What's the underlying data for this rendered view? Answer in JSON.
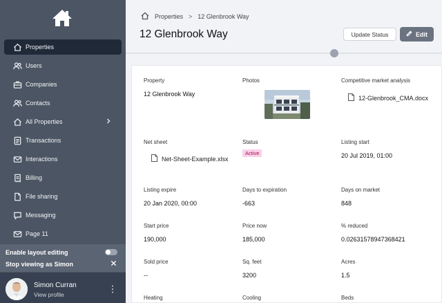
{
  "sidebar": {
    "items": [
      {
        "label": "Properties",
        "icon": "home-icon",
        "active": true
      },
      {
        "label": "Users",
        "icon": "users-icon"
      },
      {
        "label": "Companies",
        "icon": "briefcase-icon"
      },
      {
        "label": "Contacts",
        "icon": "contacts-icon"
      },
      {
        "label": "All Properties",
        "icon": "home-icon",
        "has_submenu": true
      },
      {
        "label": "Transactions",
        "icon": "document-icon"
      },
      {
        "label": "Interactions",
        "icon": "mail-icon"
      },
      {
        "label": "Billing",
        "icon": "receipt-icon"
      },
      {
        "label": "File sharing",
        "icon": "file-icon"
      },
      {
        "label": "Messaging",
        "icon": "chat-icon"
      },
      {
        "label": "Page 11",
        "icon": "mail-icon"
      }
    ],
    "layout_editing_label": "Enable layout editing",
    "stop_viewing_label": "Stop viewing as Simon",
    "profile": {
      "name": "Simon Curran",
      "link": "View profile"
    }
  },
  "header": {
    "breadcrumb": [
      "Properties",
      "12 Glenbrook Way"
    ],
    "title": "12 Glenbrook Way",
    "update_status_label": "Update Status",
    "edit_label": "Edit"
  },
  "details": {
    "property": {
      "label": "Property",
      "value": "12 Glenbrook Way"
    },
    "photos": {
      "label": "Photos"
    },
    "cma": {
      "label": "Competitive market analysis",
      "file": "12-Glenbrook_CMA.docx"
    },
    "net_sheet": {
      "label": "Net sheet",
      "file": "Net-Sheet-Example.xlsx"
    },
    "status": {
      "label": "Status",
      "value": "Active"
    },
    "listing_start": {
      "label": "Listing start",
      "value": "20 Jul 2019, 01:00"
    },
    "listing_expire": {
      "label": "Listing expire",
      "value": "20 Jan 2020, 00:00"
    },
    "days_to_expiration": {
      "label": "Days to expiration",
      "value": "-663"
    },
    "days_on_market": {
      "label": "Days on market",
      "value": "848"
    },
    "start_price": {
      "label": "Start price",
      "value": "190,000"
    },
    "price_now": {
      "label": "Price now",
      "value": "185,000"
    },
    "pct_reduced": {
      "label": "% reduced",
      "value": "0.02631578947368421"
    },
    "sold_price": {
      "label": "Sold price",
      "value": "--"
    },
    "sq_feet": {
      "label": "Sq. feet",
      "value": "3200"
    },
    "acres": {
      "label": "Acres",
      "value": "1.5"
    },
    "heating": {
      "label": "Heating"
    },
    "cooling": {
      "label": "Cooling"
    },
    "beds": {
      "label": "Beds"
    }
  },
  "colors": {
    "sidebar": "#4b5563",
    "active_item": "#1f2937",
    "status_badge": "#fbcfe8"
  }
}
